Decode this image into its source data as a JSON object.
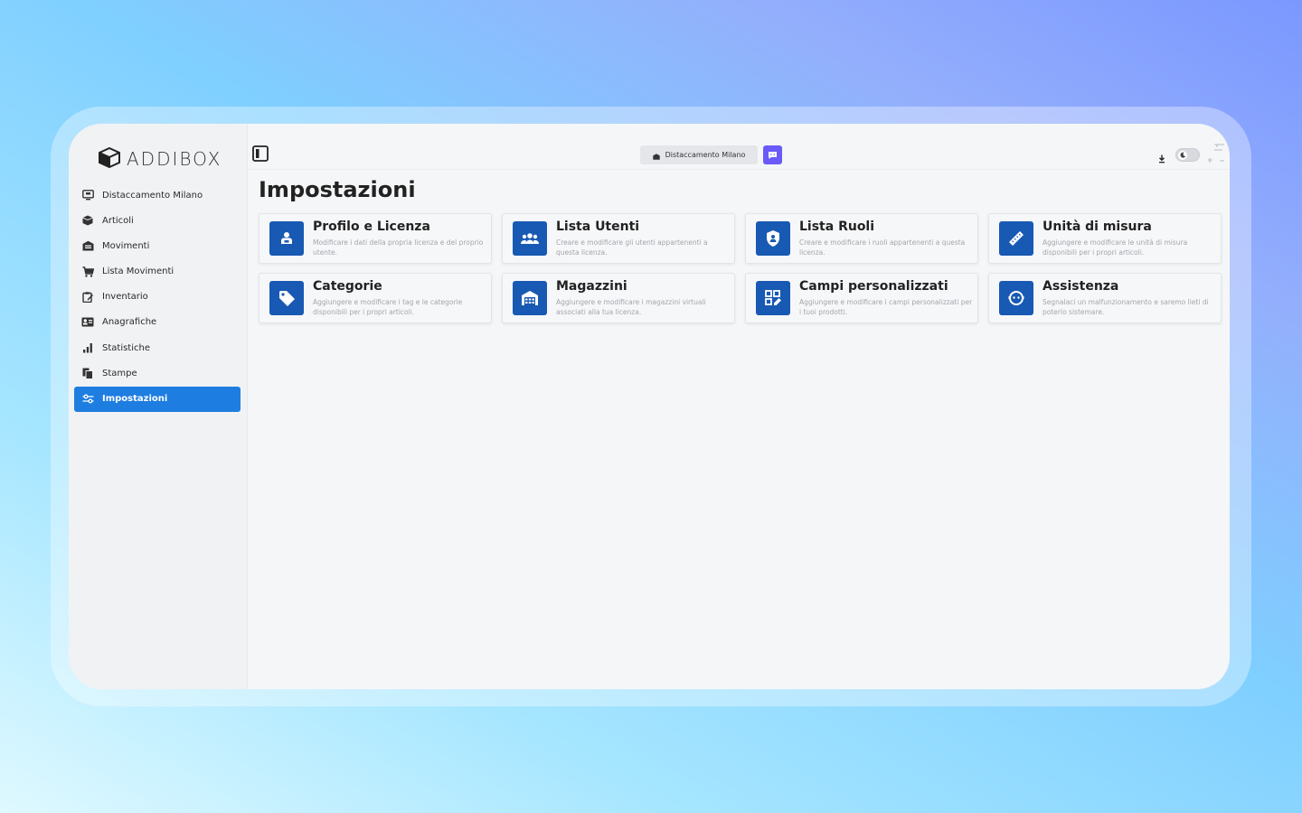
{
  "app": {
    "brand": "ADDIBOX",
    "page_title": "Impostazioni"
  },
  "sidebar": {
    "items": [
      {
        "label": "Distaccamento Milano",
        "icon": "monitor-icon",
        "active": false
      },
      {
        "label": "Articoli",
        "icon": "box-icon",
        "active": false
      },
      {
        "label": "Movimenti",
        "icon": "warehouse-icon",
        "active": false
      },
      {
        "label": "Lista Movimenti",
        "icon": "cart-icon",
        "active": false
      },
      {
        "label": "Inventario",
        "icon": "clipboard-icon",
        "active": false
      },
      {
        "label": "Anagrafiche",
        "icon": "id-card-icon",
        "active": false
      },
      {
        "label": "Statistiche",
        "icon": "bar-chart-icon",
        "active": false
      },
      {
        "label": "Stampe",
        "icon": "documents-icon",
        "active": false
      },
      {
        "label": "Impostazioni",
        "icon": "sliders-icon",
        "active": true
      }
    ]
  },
  "topbar": {
    "branch_label": "Distaccamento Milano"
  },
  "cards": [
    {
      "title": "Profilo e Licenza",
      "description": "Modificare i dati della propria licenza e del proprio utente.",
      "icon": "user-license-icon"
    },
    {
      "title": "Lista Utenti",
      "description": "Creare e modificare gli utenti appartenenti a questa licenza.",
      "icon": "users-icon"
    },
    {
      "title": "Lista Ruoli",
      "description": "Creare e modificare i ruoli appartenenti a questa licenza.",
      "icon": "shield-icon"
    },
    {
      "title": "Unità di misura",
      "description": "Aggiungere e modificare le unità di misura disponibili per i propri articoli.",
      "icon": "ruler-icon"
    },
    {
      "title": "Categorie",
      "description": "Aggiungere e modificare i tag e le categorie disponibili per i propri articoli.",
      "icon": "tag-icon"
    },
    {
      "title": "Magazzini",
      "description": "Aggiungere e modificare i magazzini virtuali associati alla tua licenza.",
      "icon": "warehouse-icon"
    },
    {
      "title": "Campi personalizzati",
      "description": "Aggiungere e modificare i campi personalizzati per i tuoi prodotti.",
      "icon": "custom-fields-icon"
    },
    {
      "title": "Assistenza",
      "description": "Segnalaci un malfunzionamento e saremo lieti di poterlo sistemare.",
      "icon": "support-icon"
    }
  ],
  "colors": {
    "accent": "#1e7de0",
    "tile": "#1859b3",
    "chat": "#6a5af9"
  }
}
